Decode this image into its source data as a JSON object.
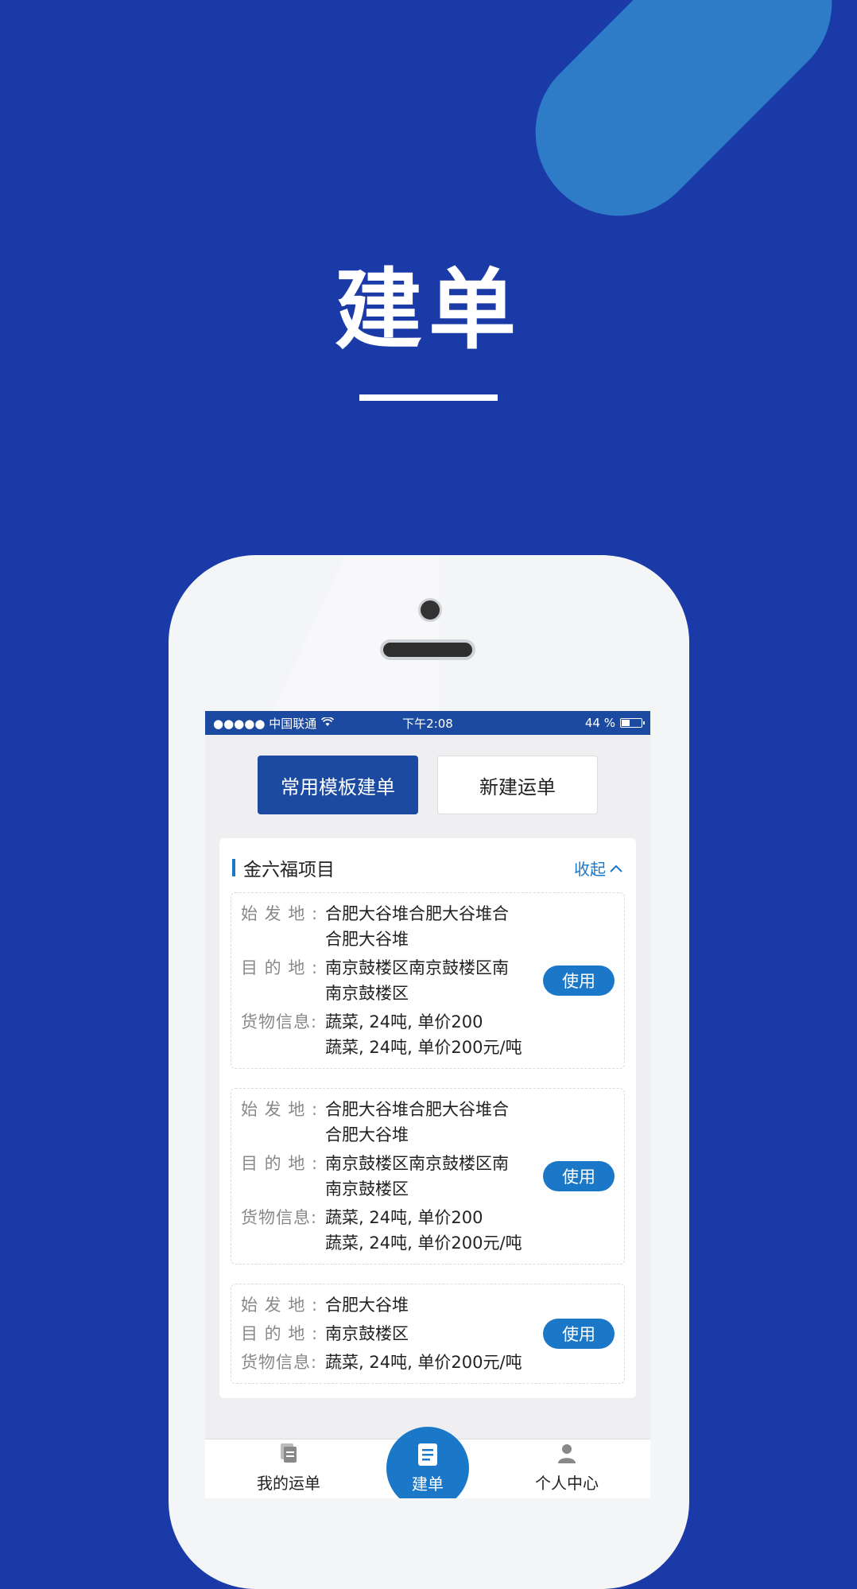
{
  "hero": {
    "title": "建单"
  },
  "status_bar": {
    "carrier": "●●●●● 中国联通",
    "time": "下午2:08",
    "battery": "44 %",
    "battery_level": 0.44
  },
  "actions": {
    "template_label": "常用模板建单",
    "new_label": "新建运单"
  },
  "project": {
    "title": "金六福项目",
    "collapse_label": "收起",
    "items": [
      {
        "origin_label": "始 发 地 :",
        "origin": "合肥大谷堆合肥大谷堆合\n合肥大谷堆",
        "dest_label": "目 的 地 :",
        "dest": "南京鼓楼区南京鼓楼区南\n南京鼓楼区",
        "goods_label": "货物信息:",
        "goods": "蔬菜, 24吨, 单价200\n蔬菜, 24吨, 单价200元/吨",
        "use_label": "使用"
      },
      {
        "origin_label": "始 发 地 :",
        "origin": "合肥大谷堆合肥大谷堆合\n合肥大谷堆",
        "dest_label": "目 的 地 :",
        "dest": "南京鼓楼区南京鼓楼区南\n南京鼓楼区",
        "goods_label": "货物信息:",
        "goods": "蔬菜, 24吨, 单价200\n蔬菜, 24吨, 单价200元/吨",
        "use_label": "使用"
      },
      {
        "origin_label": "始 发 地 :",
        "origin": "合肥大谷堆",
        "dest_label": "目 的 地 :",
        "dest": "南京鼓楼区",
        "goods_label": "货物信息:",
        "goods": "蔬菜, 24吨, 单价200元/吨",
        "use_label": "使用"
      }
    ]
  },
  "tabbar": {
    "orders": "我的运单",
    "create": "建单",
    "profile": "个人中心"
  },
  "colors": {
    "background": "#1a3aa8",
    "primary": "#1b4aa0",
    "accent": "#1b78c8"
  }
}
